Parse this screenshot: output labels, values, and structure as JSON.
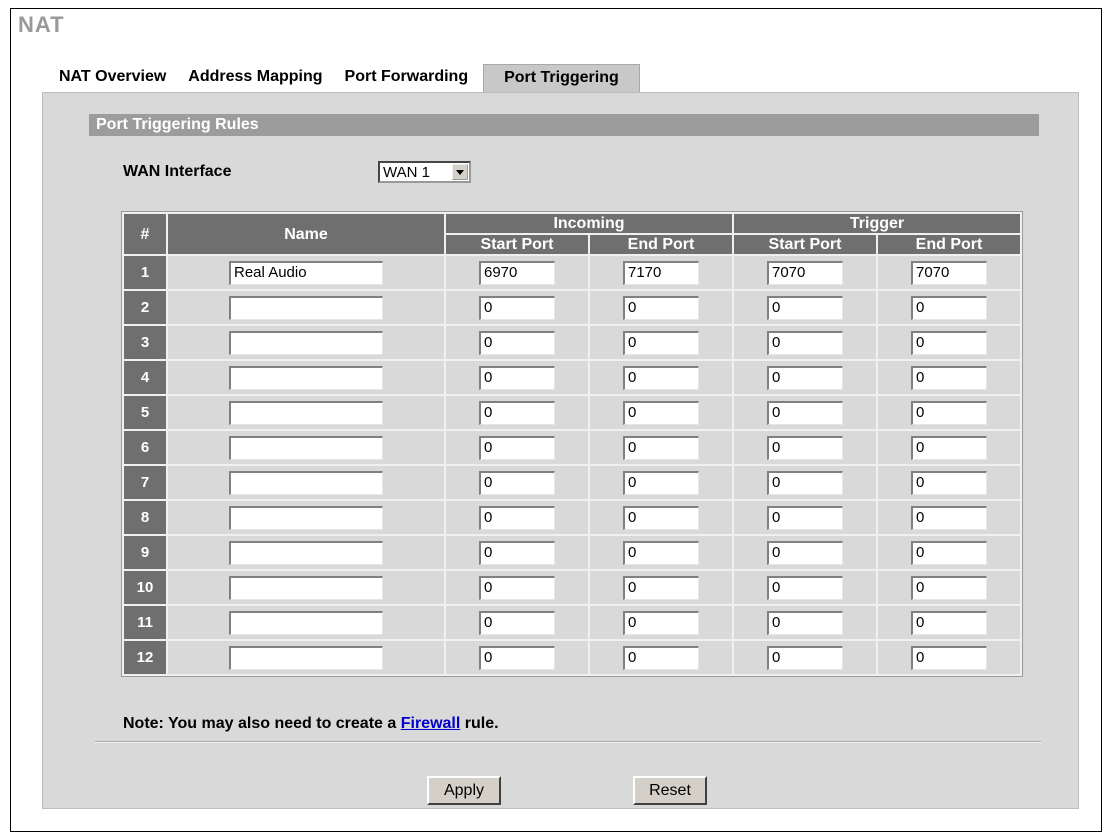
{
  "page": {
    "title": "NAT"
  },
  "tabs": [
    {
      "label": "NAT Overview",
      "active": false
    },
    {
      "label": "Address Mapping",
      "active": false
    },
    {
      "label": "Port Forwarding",
      "active": false
    },
    {
      "label": "Port Triggering",
      "active": true
    }
  ],
  "section": {
    "title": "Port Triggering Rules"
  },
  "wan": {
    "label": "WAN Interface",
    "selected": "WAN 1"
  },
  "table": {
    "headers": {
      "num": "#",
      "name": "Name",
      "incoming": "Incoming",
      "trigger": "Trigger",
      "start_port": "Start Port",
      "end_port": "End Port"
    },
    "rows": [
      {
        "num": "1",
        "name": "Real Audio",
        "in_start": "6970",
        "in_end": "7170",
        "tr_start": "7070",
        "tr_end": "7070"
      },
      {
        "num": "2",
        "name": "",
        "in_start": "0",
        "in_end": "0",
        "tr_start": "0",
        "tr_end": "0"
      },
      {
        "num": "3",
        "name": "",
        "in_start": "0",
        "in_end": "0",
        "tr_start": "0",
        "tr_end": "0"
      },
      {
        "num": "4",
        "name": "",
        "in_start": "0",
        "in_end": "0",
        "tr_start": "0",
        "tr_end": "0"
      },
      {
        "num": "5",
        "name": "",
        "in_start": "0",
        "in_end": "0",
        "tr_start": "0",
        "tr_end": "0"
      },
      {
        "num": "6",
        "name": "",
        "in_start": "0",
        "in_end": "0",
        "tr_start": "0",
        "tr_end": "0"
      },
      {
        "num": "7",
        "name": "",
        "in_start": "0",
        "in_end": "0",
        "tr_start": "0",
        "tr_end": "0"
      },
      {
        "num": "8",
        "name": "",
        "in_start": "0",
        "in_end": "0",
        "tr_start": "0",
        "tr_end": "0"
      },
      {
        "num": "9",
        "name": "",
        "in_start": "0",
        "in_end": "0",
        "tr_start": "0",
        "tr_end": "0"
      },
      {
        "num": "10",
        "name": "",
        "in_start": "0",
        "in_end": "0",
        "tr_start": "0",
        "tr_end": "0"
      },
      {
        "num": "11",
        "name": "",
        "in_start": "0",
        "in_end": "0",
        "tr_start": "0",
        "tr_end": "0"
      },
      {
        "num": "12",
        "name": "",
        "in_start": "0",
        "in_end": "0",
        "tr_start": "0",
        "tr_end": "0"
      }
    ]
  },
  "note": {
    "prefix": "Note: You may also need to create a ",
    "link": "Firewall",
    "suffix": " rule."
  },
  "buttons": {
    "apply": "Apply",
    "reset": "Reset"
  }
}
